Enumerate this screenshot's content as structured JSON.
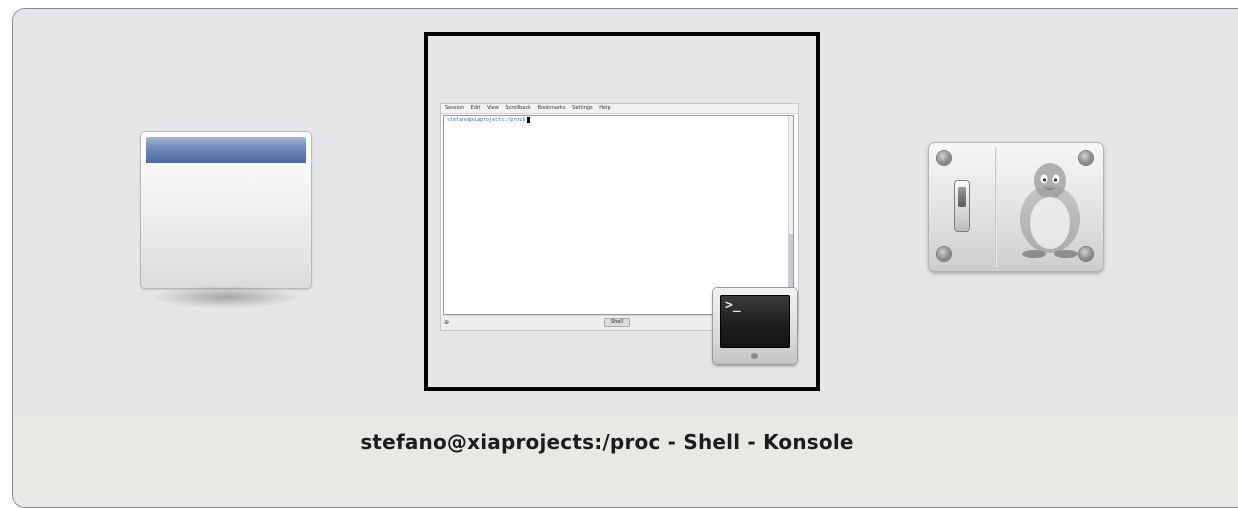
{
  "switcher": {
    "caption": "stefano@xiaprojects:/proc - Shell - Konsole",
    "selected_border_color": "#000000",
    "background_color": "#e4e6e7",
    "caption_bar_color": "#e9e8e5"
  },
  "windows": [
    {
      "name": "generic-window",
      "icon": "window-icon",
      "selected": false
    },
    {
      "name": "konsole-window",
      "icon": "konsole-icon",
      "selected": true,
      "preview": {
        "menu_items": [
          "Session",
          "Edit",
          "View",
          "Scrollback",
          "Bookmarks",
          "Settings",
          "Help"
        ],
        "prompt": "stefano@xiaprojects:/proc$",
        "tab_label": "Shell",
        "new_tab_glyph": "⊕",
        "close_tab_glyph": "⊗"
      },
      "app_icon_glyph": ">_"
    },
    {
      "name": "system-settings-window",
      "icon": "system-settings-icon",
      "selected": false
    }
  ]
}
